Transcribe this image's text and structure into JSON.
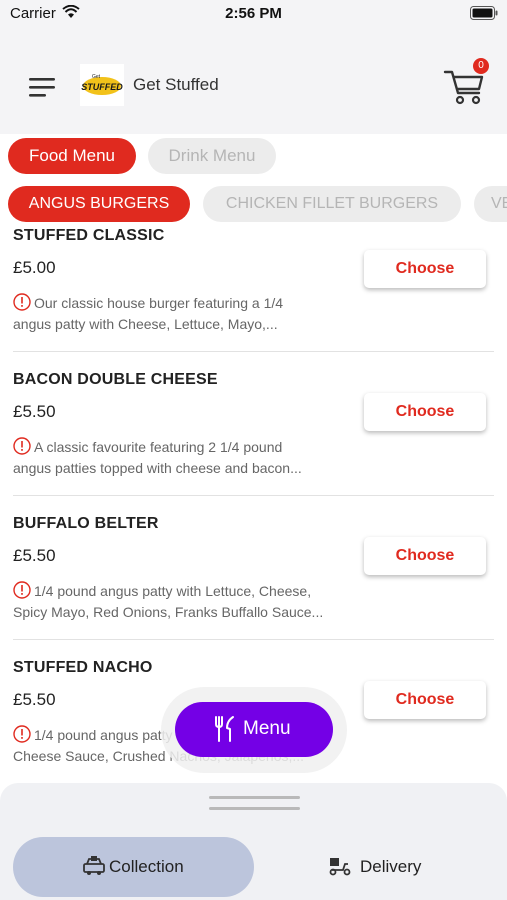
{
  "status_bar": {
    "carrier": "Carrier",
    "time": "2:56 PM"
  },
  "header": {
    "title": "Get Stuffed",
    "logo_text": "Get STUFFED",
    "cart_count": "0"
  },
  "menu_tabs": [
    {
      "label": "Food Menu",
      "active": true
    },
    {
      "label": "Drink Menu",
      "active": false
    }
  ],
  "categories": [
    {
      "label": "ANGUS BURGERS",
      "active": true
    },
    {
      "label": "CHICKEN FILLET BURGERS",
      "active": false
    },
    {
      "label": "VE",
      "active": false
    }
  ],
  "items": [
    {
      "name": "STUFFED CLASSIC",
      "price": "£5.00",
      "desc_line1": "Our classic house burger featuring a 1/4",
      "desc_line2": "angus patty with Cheese, Lettuce, Mayo,...",
      "button": "Choose"
    },
    {
      "name": "BACON DOUBLE CHEESE",
      "price": "£5.50",
      "desc_line1": "A classic favourite featuring 2 1/4 pound",
      "desc_line2": "angus patties topped with cheese and bacon...",
      "button": "Choose"
    },
    {
      "name": "BUFFALO BELTER",
      "price": "£5.50",
      "desc_line1": "1/4 pound angus patty with Lettuce, Cheese,",
      "desc_line2": "Spicy Mayo, Red Onions, Franks Buffallo Sauce...",
      "button": "Choose"
    },
    {
      "name": "STUFFED NACHO",
      "price": "£5.50",
      "desc_line1": "1/4 pound angus patty",
      "desc_line2": "Cheese Sauce, Crushed Nachos, Jalapenos,...",
      "button": "Choose"
    }
  ],
  "fab": {
    "label": "Menu"
  },
  "order_mode": [
    {
      "label": "Collection",
      "active": true,
      "icon": "collection-icon"
    },
    {
      "label": "Delivery",
      "active": false,
      "icon": "delivery-scooter-icon"
    }
  ],
  "colors": {
    "accent": "#e02a1f",
    "fab": "#7400e6",
    "header_bg": "#f4f4f6",
    "collection_active": "#bcc5dc"
  }
}
